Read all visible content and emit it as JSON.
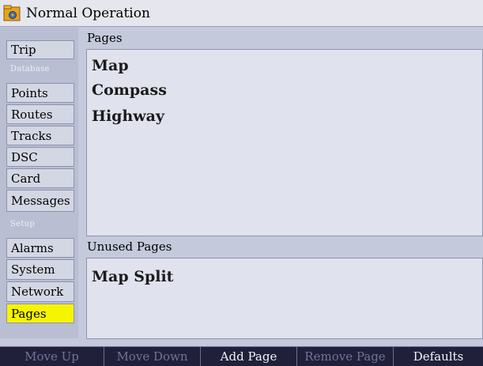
{
  "title": {
    "text": "Normal Operation",
    "icon": "gear-folder-icon"
  },
  "sidebar": {
    "items": [
      {
        "label": "Trip",
        "type": "item",
        "selected": false
      },
      {
        "label": "Database",
        "type": "section"
      },
      {
        "label": "Points",
        "type": "item",
        "selected": false
      },
      {
        "label": "Routes",
        "type": "item",
        "selected": false
      },
      {
        "label": "Tracks",
        "type": "item",
        "selected": false
      },
      {
        "label": "DSC",
        "type": "item",
        "selected": false
      },
      {
        "label": "Card",
        "type": "item",
        "selected": false
      },
      {
        "label": "Messages",
        "type": "item",
        "selected": false
      },
      {
        "label": "Setup",
        "type": "section"
      },
      {
        "label": "Alarms",
        "type": "item",
        "selected": false
      },
      {
        "label": "System",
        "type": "item",
        "selected": false
      },
      {
        "label": "Network",
        "type": "item",
        "selected": false
      },
      {
        "label": "Pages",
        "type": "item",
        "selected": true
      }
    ]
  },
  "pages_panel": {
    "header": "Pages",
    "items": [
      "Map",
      "Compass",
      "Highway"
    ]
  },
  "unused_panel": {
    "header": "Unused Pages",
    "items": [
      "Map Split"
    ]
  },
  "softkeys": [
    {
      "label": "Move Up",
      "enabled": false
    },
    {
      "label": "Move Down",
      "enabled": false
    },
    {
      "label": "Add Page",
      "enabled": true
    },
    {
      "label": "Remove Page",
      "enabled": false
    },
    {
      "label": "Defaults",
      "enabled": true
    }
  ],
  "colors": {
    "selected": "#f6f400",
    "background": "#c4c9dc",
    "softkey_bar": "#20203a"
  }
}
